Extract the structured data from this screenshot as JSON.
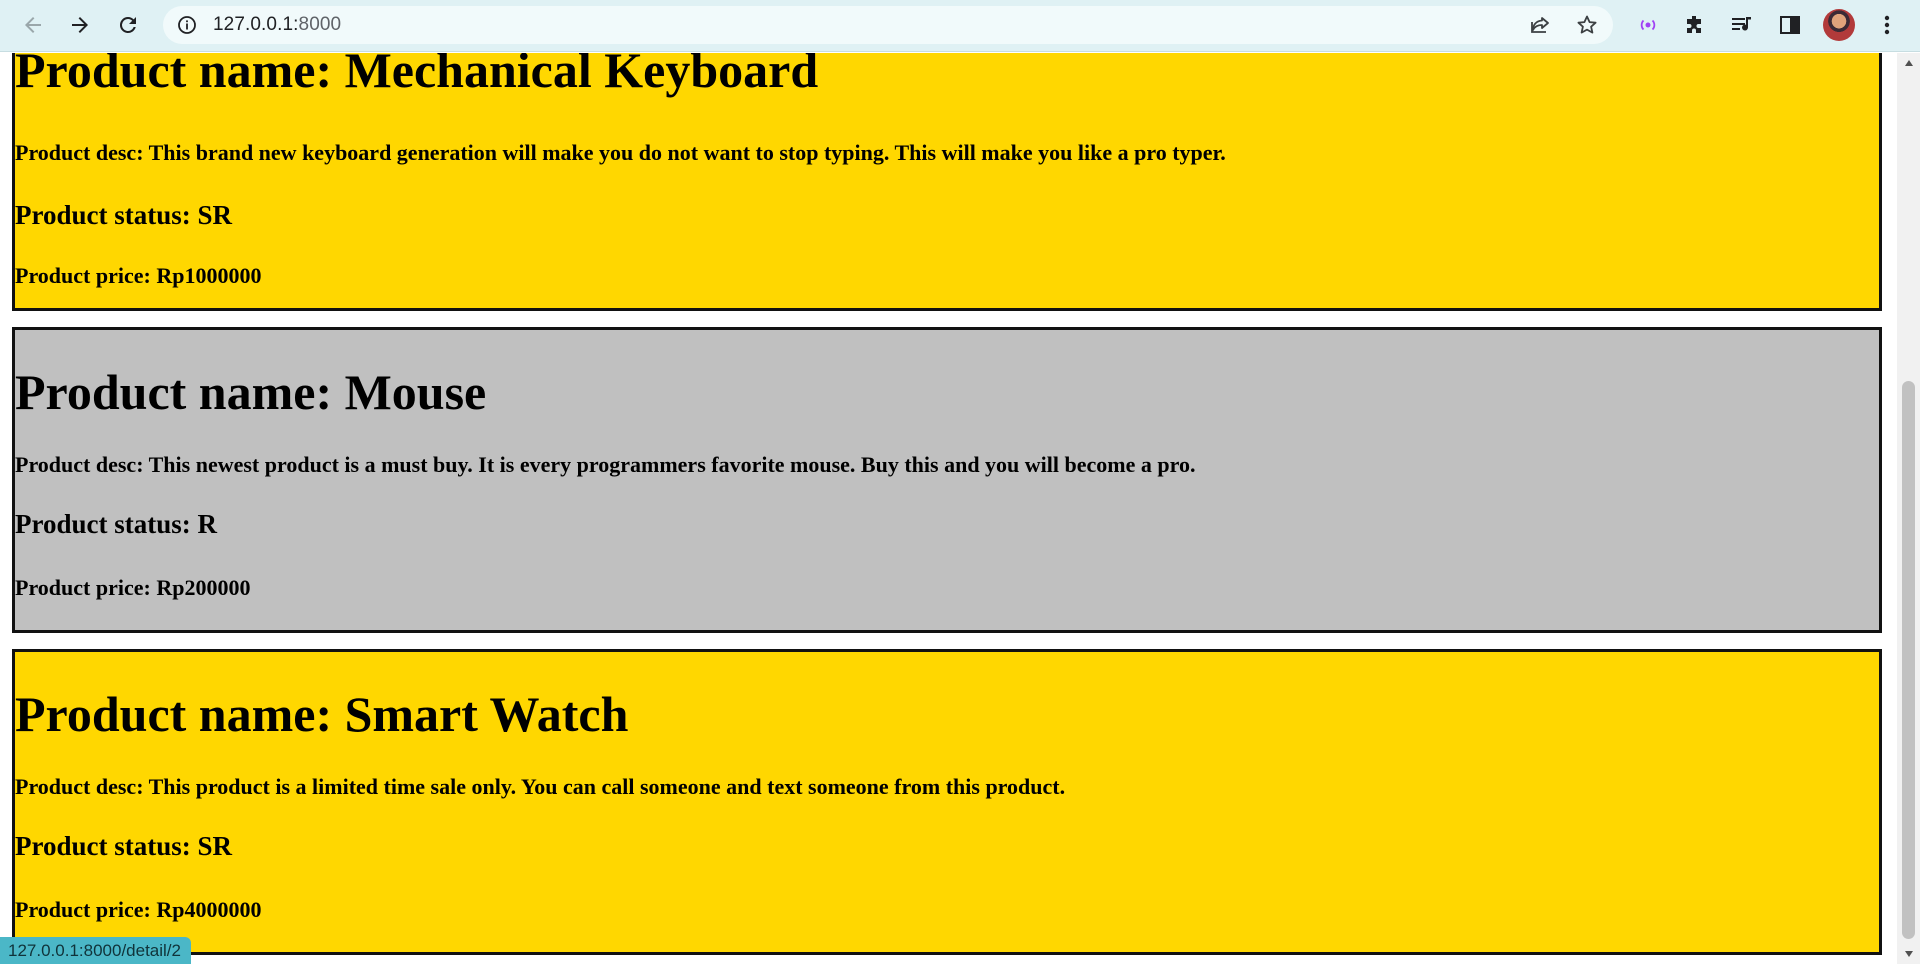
{
  "browser": {
    "url_host": "127.0.0.1:",
    "url_port": "8000",
    "status_url": "127.0.0.1:8000/detail/2"
  },
  "colors": {
    "card_ready_stock": "#ffd700",
    "card_regular": "#c0c0c0",
    "chrome_bg": "#dff1f4",
    "status_bubble": "#4bb7c7"
  },
  "products": [
    {
      "name": "Product name: Mechanical Keyboard",
      "desc": "Product desc: This brand new keyboard generation will make you do not want to stop typing. This will make you like a pro typer.",
      "status": "Product status: SR",
      "price": "Product price: Rp1000000",
      "color": "yellow"
    },
    {
      "name": "Product name: Mouse",
      "desc": "Product desc: This newest product is a must buy. It is every programmers favorite mouse. Buy this and you will become a pro.",
      "status": "Product status: R",
      "price": "Product price: Rp200000",
      "color": "gray"
    },
    {
      "name": "Product name: Smart Watch",
      "desc": "Product desc: This product is a limited time sale only. You can call someone and text someone from this product.",
      "status": "Product status: SR",
      "price": "Product price: Rp4000000",
      "color": "yellow"
    }
  ]
}
